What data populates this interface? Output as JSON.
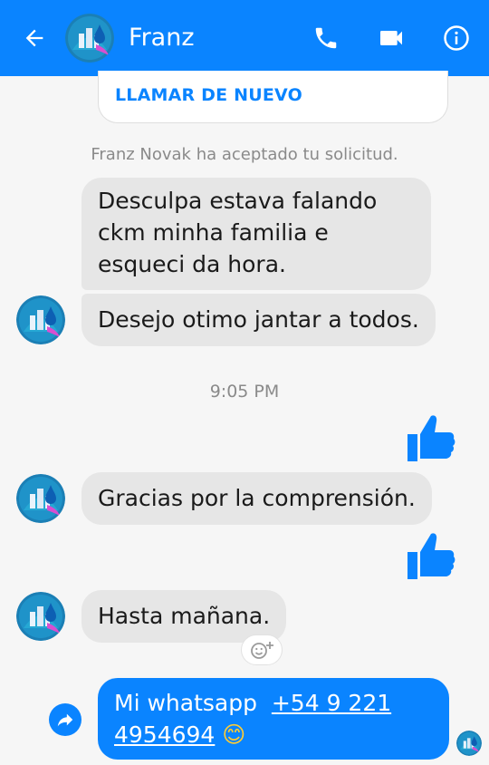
{
  "header": {
    "title": "Franz",
    "color": "#0a84ff",
    "icons": [
      "back-arrow-icon",
      "phone-icon",
      "video-camera-icon",
      "info-icon"
    ]
  },
  "call_card": {
    "label": "LLAMAR DE NUEVO"
  },
  "system_message": "Franz Novak ha aceptado tu solicitud.",
  "messages": [
    {
      "from": "Franz",
      "lines": [
        "Desculpa  estava falando",
        "ckm minha familia e",
        "esqueci da hora."
      ]
    },
    {
      "from": "Franz",
      "text": "Desejo otimo jantar a todos."
    },
    {
      "timestamp": "9:05 PM"
    },
    {
      "from": "me",
      "type": "like"
    },
    {
      "from": "Franz",
      "text": "Gracias por la comprensión."
    },
    {
      "from": "me",
      "type": "like"
    },
    {
      "from": "Franz",
      "text": "Hasta mañana."
    },
    {
      "from": "me",
      "prefix": "Mi whatsapp  ",
      "link_line1": "+54 9 221",
      "link_line2": "4954694",
      "emoji": "😊"
    }
  ],
  "colors": {
    "incoming_bubble": "#e6e6e6",
    "outgoing_bubble": "#0a84ff",
    "background": "#f6f6f6"
  }
}
